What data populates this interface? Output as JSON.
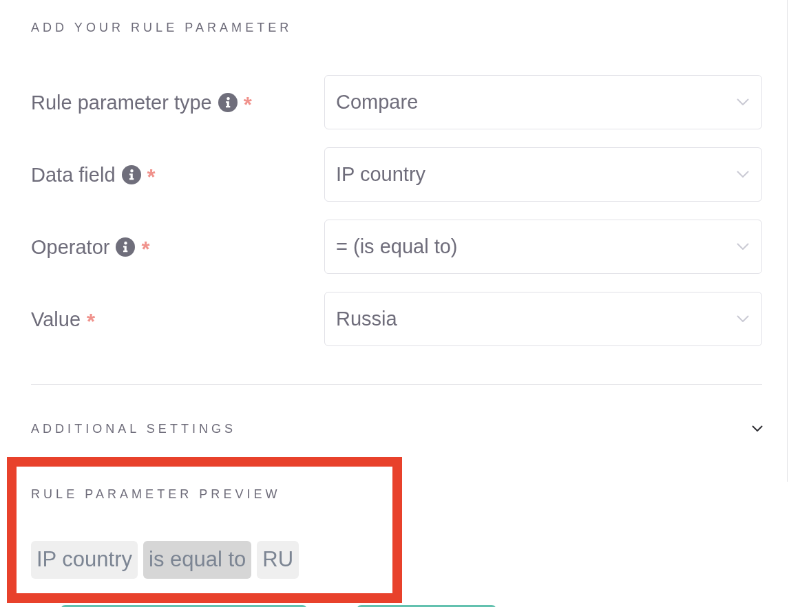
{
  "header": {
    "title": "ADD YOUR RULE PARAMETER"
  },
  "fields": [
    {
      "label": "Rule parameter type",
      "info": true,
      "required_mark": "*",
      "value": "Compare"
    },
    {
      "label": "Data field",
      "info": true,
      "required_mark": "*",
      "value": "IP country"
    },
    {
      "label": "Operator",
      "info": true,
      "required_mark": "*",
      "value": "= (is equal to)"
    },
    {
      "label": "Value",
      "info": false,
      "required_mark": "*",
      "value": "Russia"
    }
  ],
  "additional_settings": {
    "title": "ADDITIONAL SETTINGS",
    "expanded": false
  },
  "preview": {
    "title": "RULE PARAMETER PREVIEW",
    "highlighted": true,
    "chips": [
      {
        "kind": "field",
        "text": "IP country"
      },
      {
        "kind": "operator",
        "text": "is equal to"
      },
      {
        "kind": "value",
        "text": "RU"
      }
    ]
  }
}
